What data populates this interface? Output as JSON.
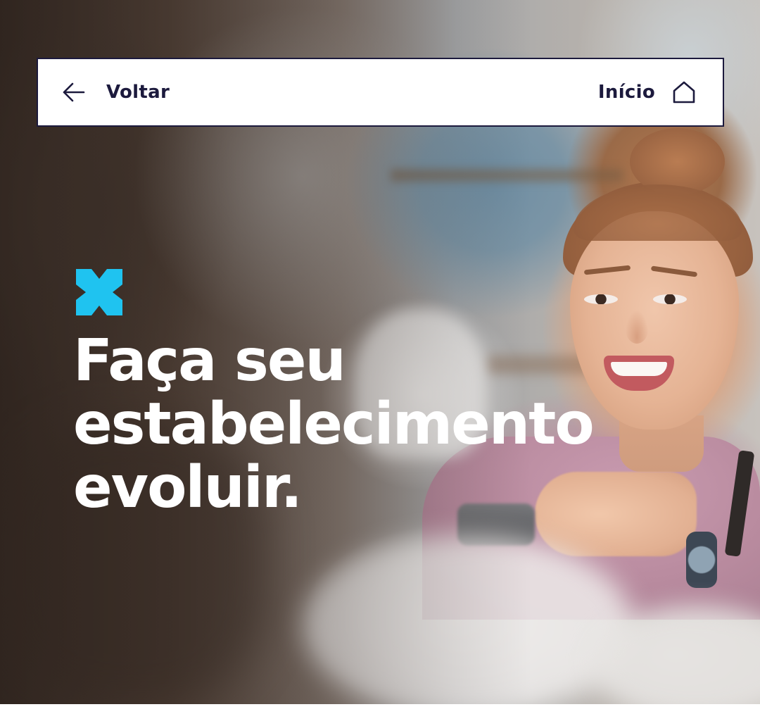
{
  "navbar": {
    "back_icon": "arrow-left-icon",
    "back_label": "Voltar",
    "home_label": "Início",
    "home_icon": "home-icon"
  },
  "hero": {
    "brand_mark": "cross-logo-icon",
    "headline_lines": [
      "Faça seu",
      "estabelecimento",
      "evoluir."
    ]
  },
  "colors": {
    "navy": "#1c1a3d",
    "accent_cyan": "#1fc3f0",
    "headline_text": "#ffffff",
    "nav_background": "#ffffff"
  }
}
